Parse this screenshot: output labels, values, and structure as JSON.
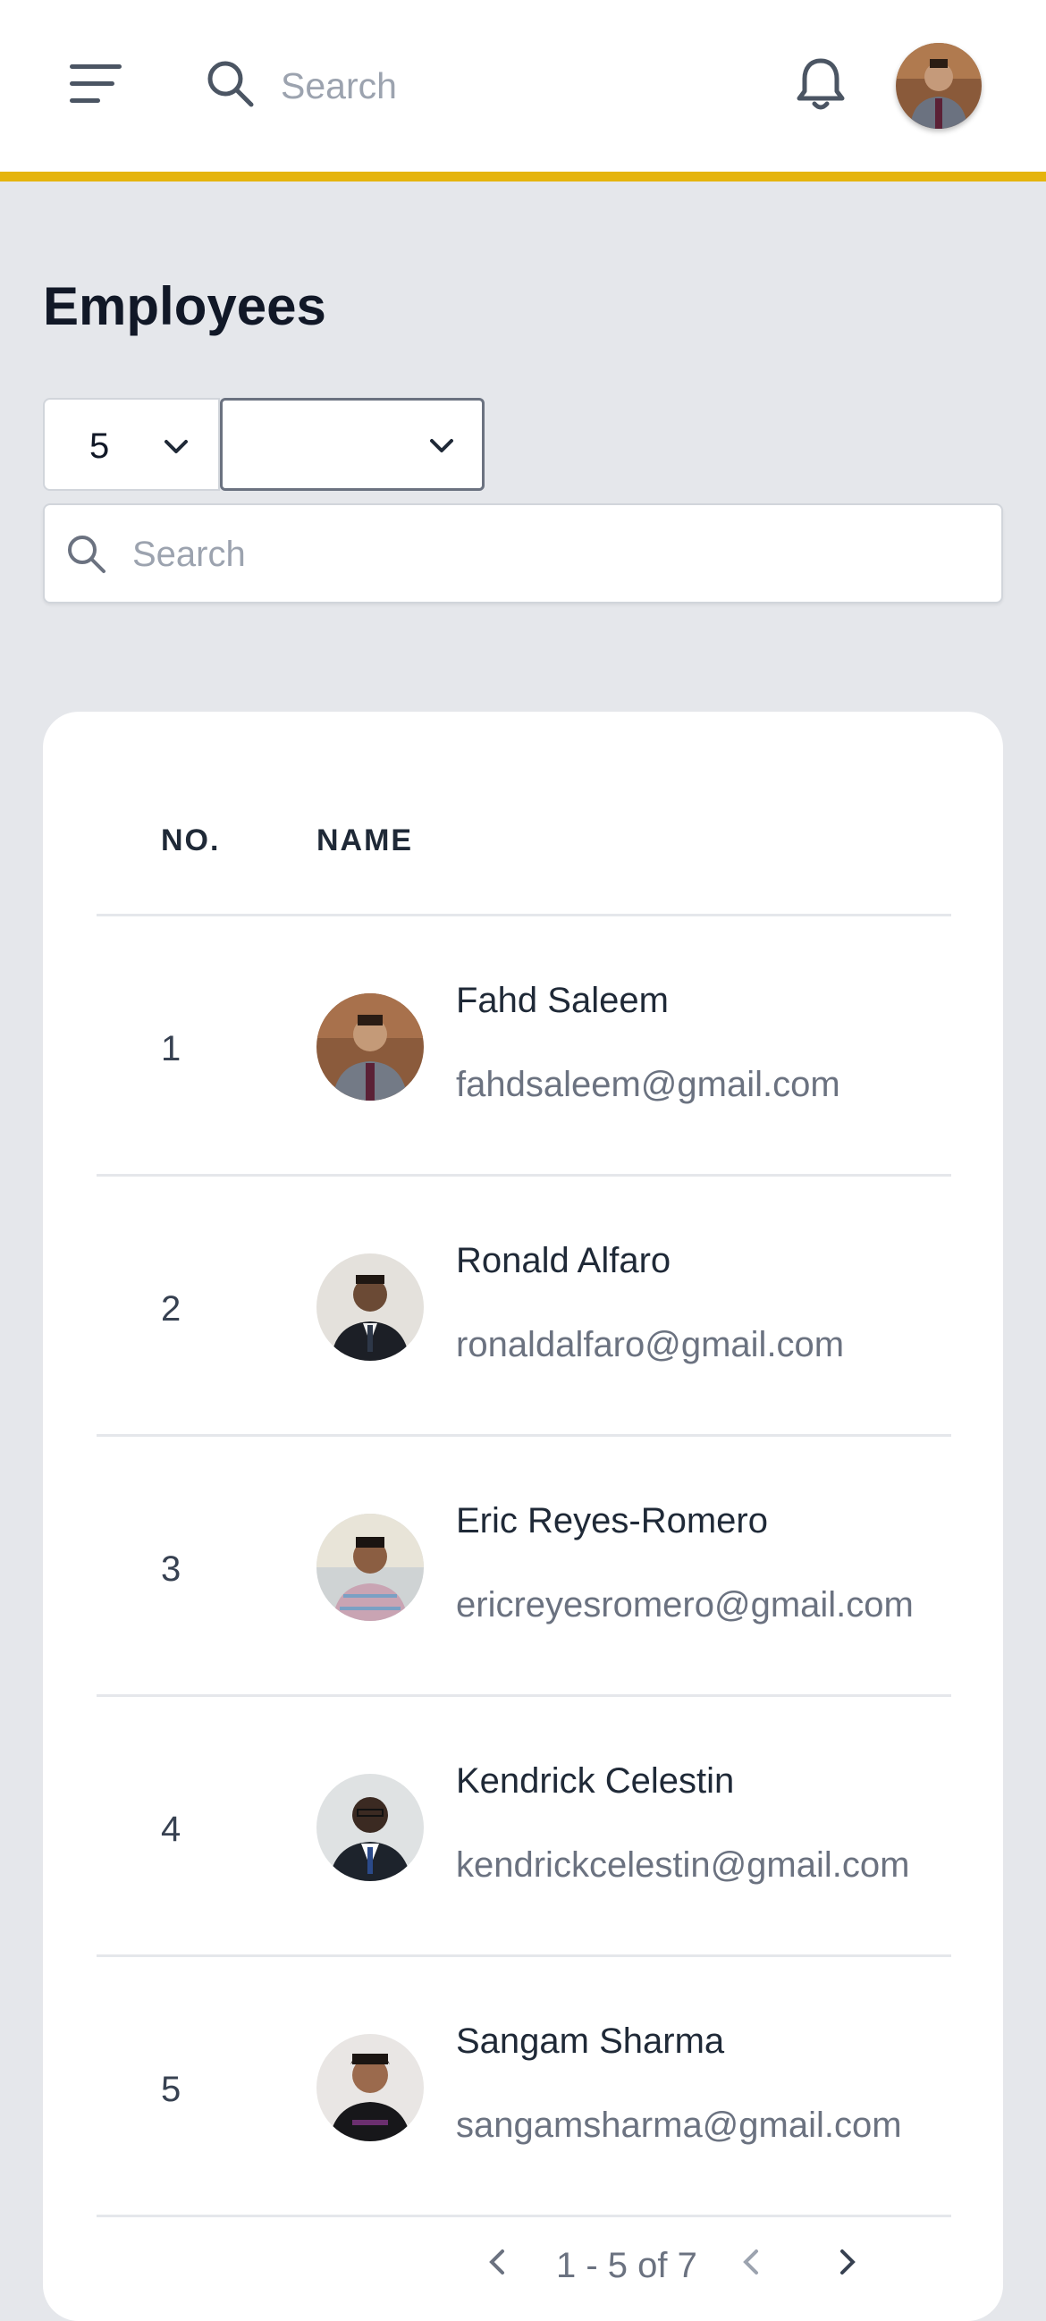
{
  "header": {
    "search_placeholder": "Search",
    "icons": {
      "menu": "menu-icon",
      "search": "search-icon",
      "notifications": "bell-icon"
    },
    "accent_color": "#e5b40d"
  },
  "page": {
    "title": "Employees",
    "page_size": "5",
    "filter_value": "",
    "search_placeholder": "Search"
  },
  "table": {
    "columns": [
      "NO.",
      "NAME"
    ],
    "rows": [
      {
        "no": "1",
        "name": "Fahd Saleem",
        "email": "fahdsaleem@gmail.com"
      },
      {
        "no": "2",
        "name": "Ronald Alfaro",
        "email": "ronaldalfaro@gmail.com"
      },
      {
        "no": "3",
        "name": "Eric Reyes-Romero",
        "email": "ericreyesromero@gmail.com"
      },
      {
        "no": "4",
        "name": "Kendrick Celestin",
        "email": "kendrickcelestin@gmail.com"
      },
      {
        "no": "5",
        "name": "Sangam Sharma",
        "email": "sangamsharma@gmail.com"
      }
    ]
  },
  "pagination": {
    "label": "1 - 5 of 7"
  }
}
